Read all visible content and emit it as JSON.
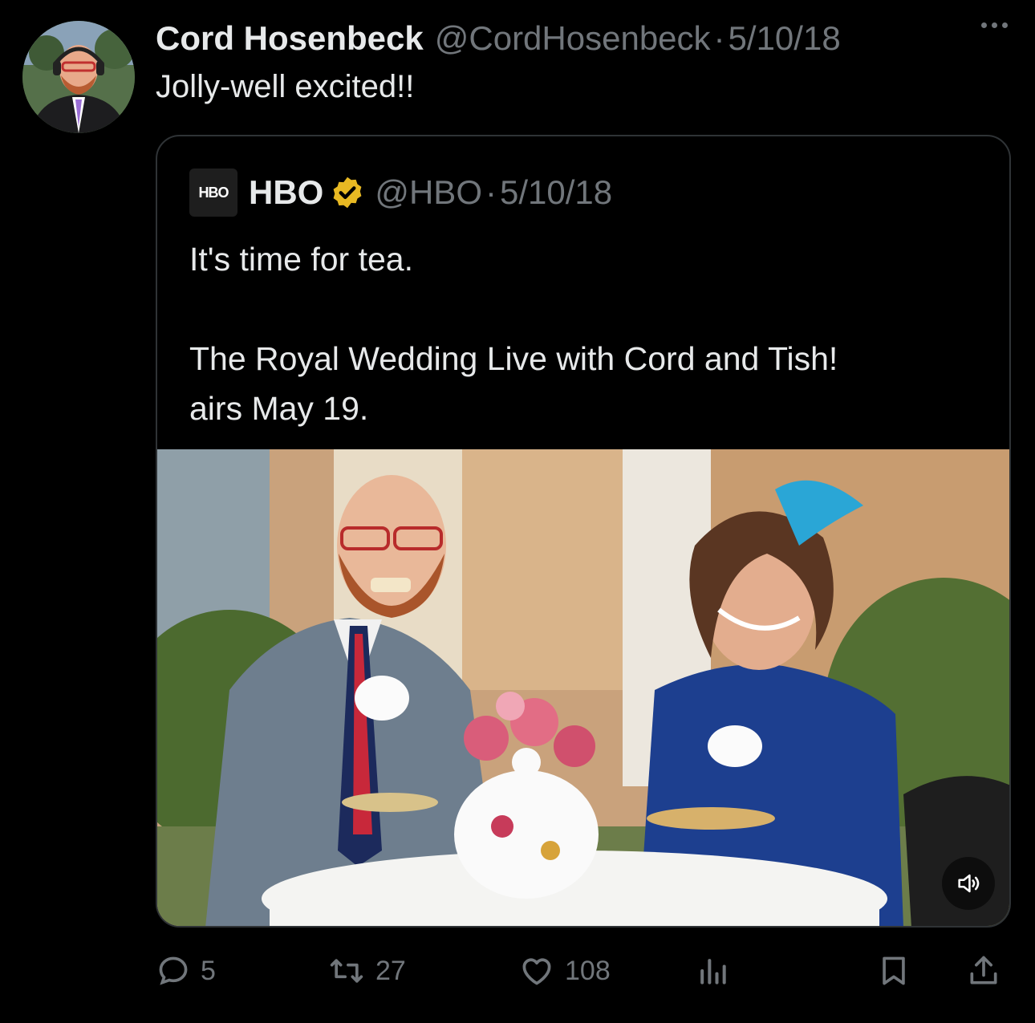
{
  "author": {
    "name": "Cord Hosenbeck",
    "handle": "@CordHosenbeck",
    "separator": "·",
    "date": "5/10/18",
    "avatar_icon": "profile-photo-man-headset"
  },
  "tweet": {
    "text": "Jolly-well excited!!"
  },
  "quoted": {
    "logo_text": "HBO",
    "name": "HBO",
    "verified_icon": "verified-gold-badge",
    "handle": "@HBO",
    "separator": "·",
    "date": "5/10/18",
    "line1": "It's time for tea.",
    "line2": "The Royal Wedding Live with Cord and Tish!",
    "line3": "airs May 19.",
    "media_icon": "video-thumbnail-tea-party",
    "mute_icon": "speaker-icon"
  },
  "actions": {
    "reply_count": "5",
    "retweet_count": "27",
    "like_count": "108"
  },
  "colors": {
    "background": "#000000",
    "text": "#e7e9ea",
    "muted": "#71767b",
    "border": "#2f3336",
    "verified": "#e8b923"
  }
}
